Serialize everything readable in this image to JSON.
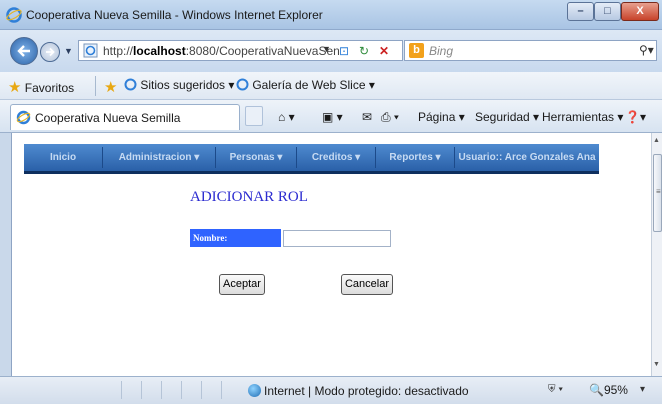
{
  "window": {
    "title": "Cooperativa Nueva Semilla - Windows Internet Explorer",
    "controls": {
      "minimize": "–",
      "maximize": "□",
      "close": "X"
    }
  },
  "address_bar": {
    "url_prefix": "http://",
    "url_host": "localhost",
    "url_rest": ":8080/CooperativaNuevaSen",
    "search_placeholder": "Bing"
  },
  "favorites_bar": {
    "favorites_label": "Favoritos",
    "items": [
      "Sitios sugeridos ▾",
      "Galería de Web Slice ▾"
    ]
  },
  "tab": {
    "label": "Cooperativa Nueva Semilla"
  },
  "command_bar": {
    "pagina": "Página ▾",
    "seguridad": "Seguridad ▾",
    "herramientas": "Herramientas ▾"
  },
  "app_menu": {
    "items": [
      "Inicio",
      "Administracion  ▾",
      "Personas  ▾",
      "Creditos  ▾",
      "Reportes  ▾",
      "Usuario:: Arce Gonzales Ana"
    ]
  },
  "form": {
    "title": "ADICIONAR ROL",
    "nombre_label": "Nombre:",
    "nombre_value": "",
    "accept_label": "Aceptar",
    "cancel_label": "Cancelar"
  },
  "status_bar": {
    "zone_text": "Internet | Modo protegido: desactivado",
    "zoom": "95%"
  },
  "colors": {
    "menu_bar": "#2a60a8",
    "menu_text": "#c7dbf3",
    "title_text": "#2b2bd0",
    "label_bg": "#2f63ff"
  }
}
